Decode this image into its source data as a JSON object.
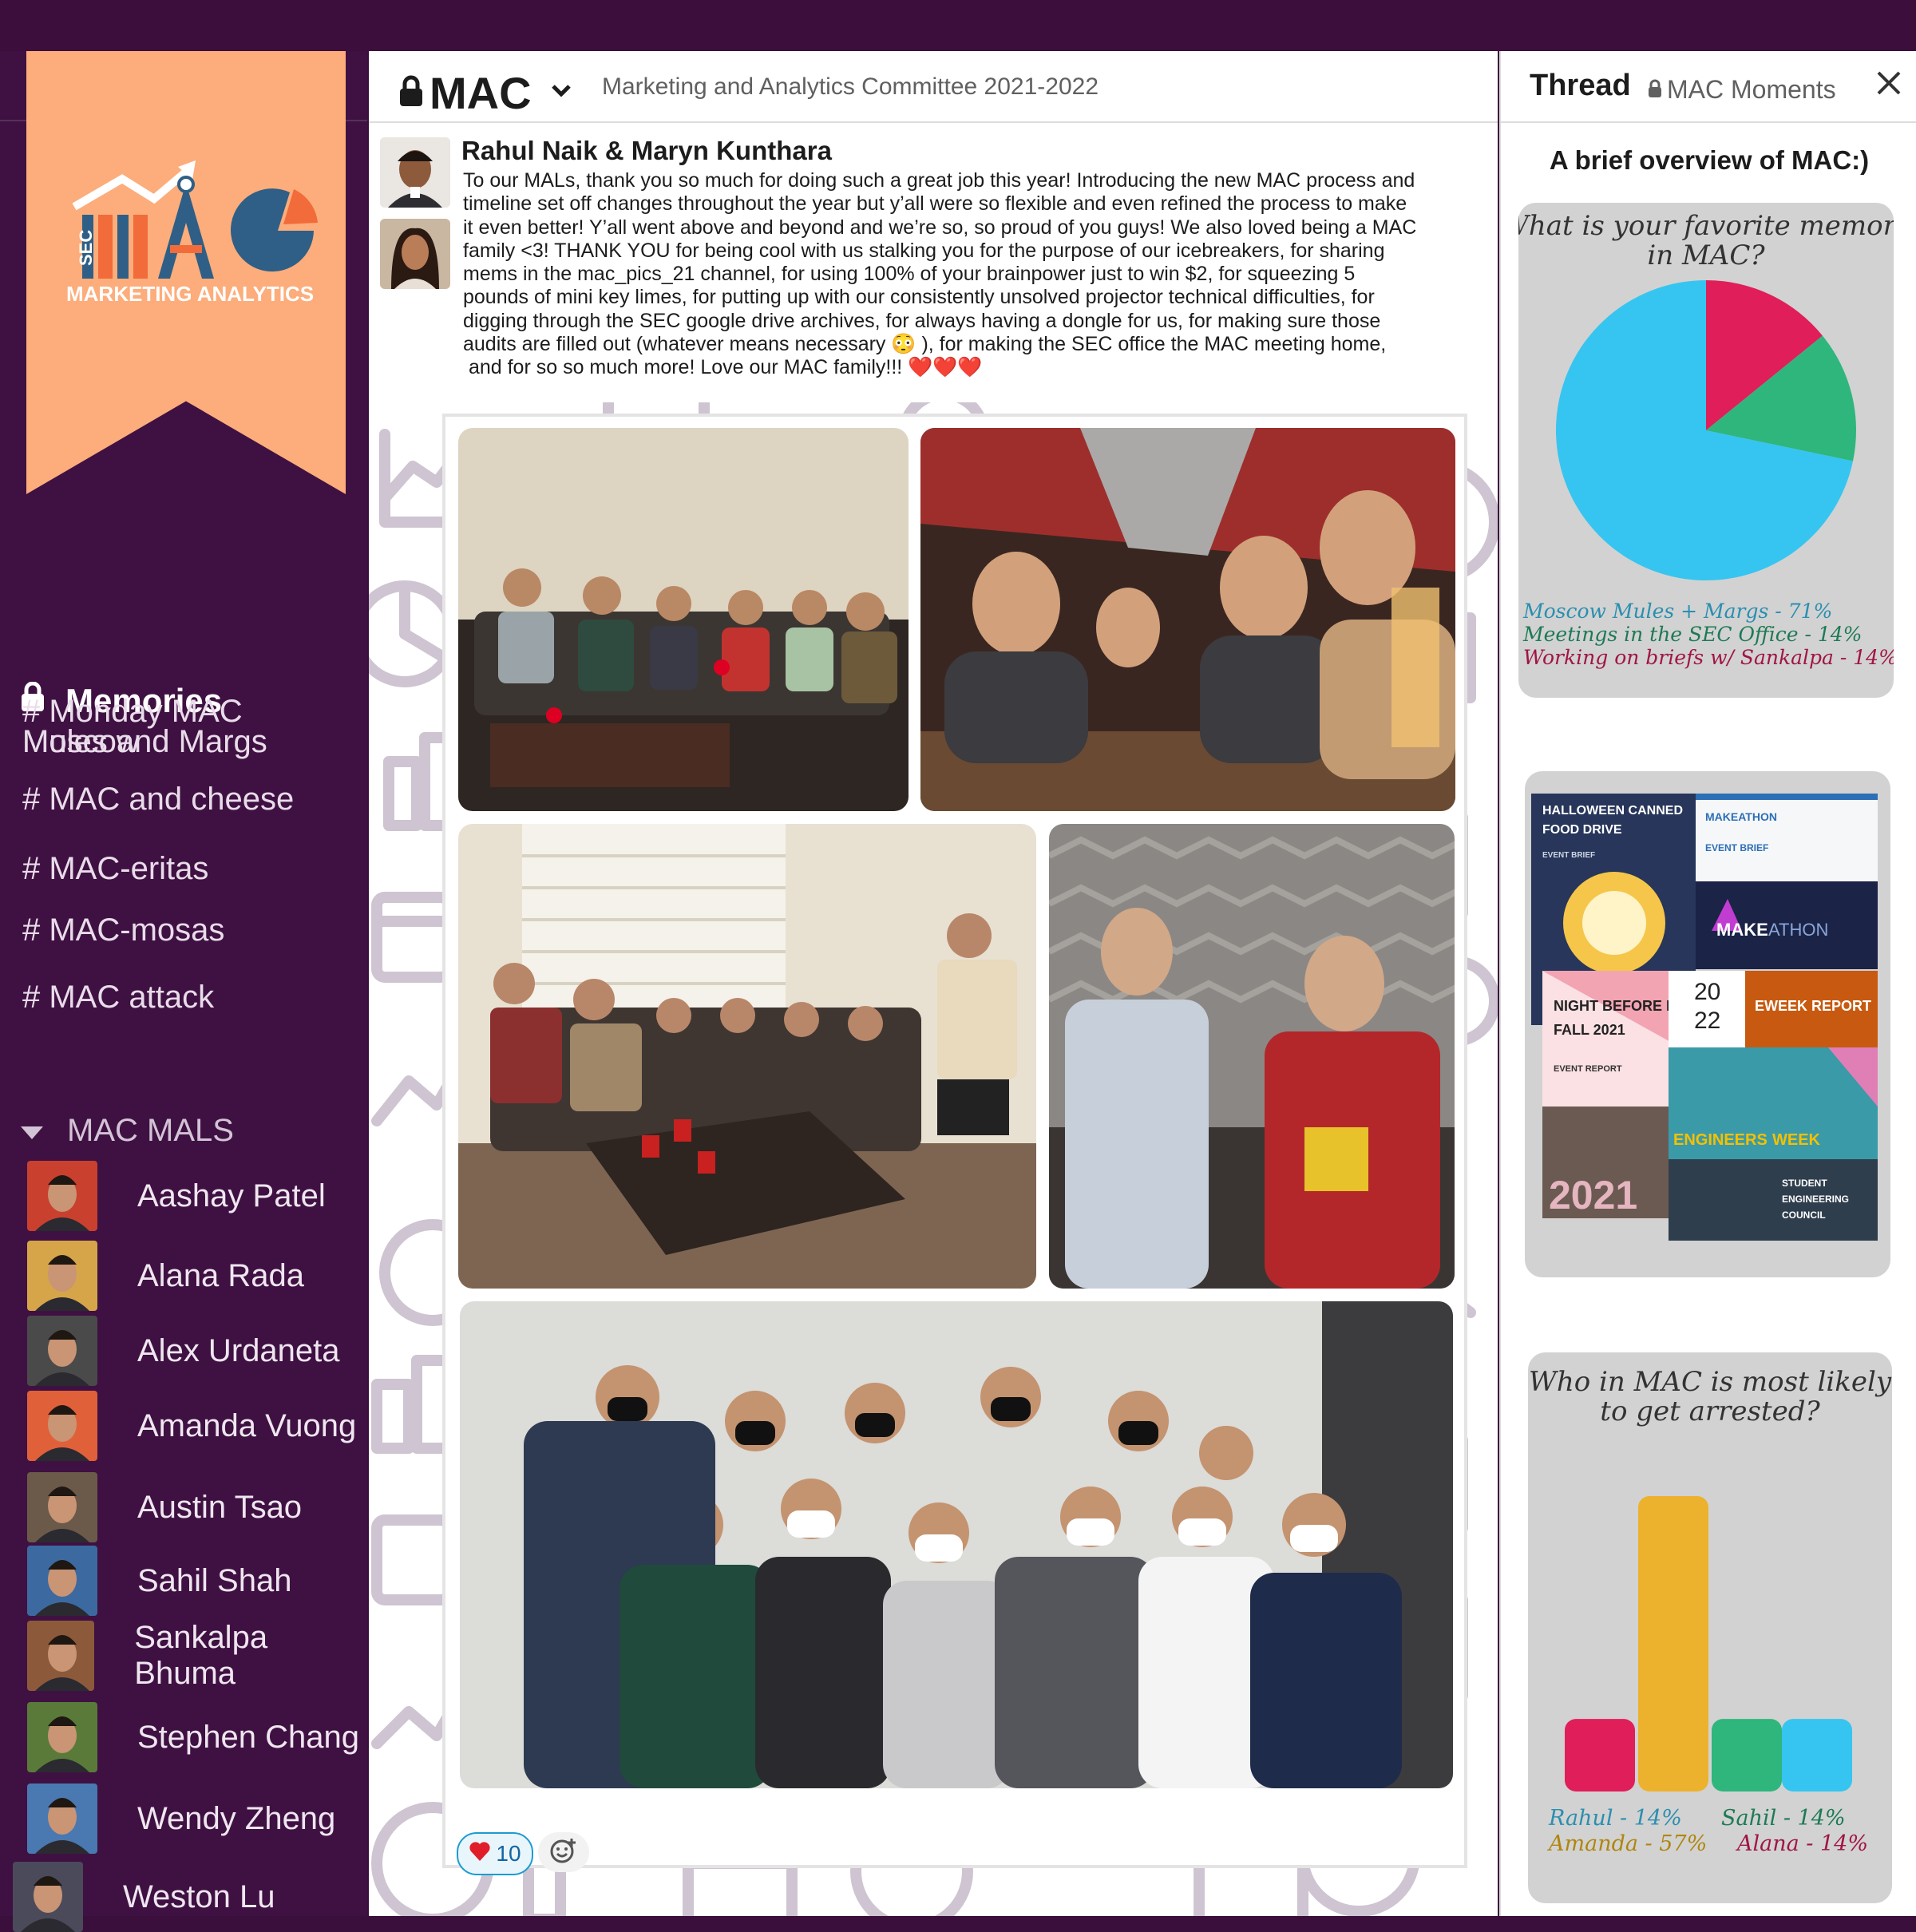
{
  "sidebar": {
    "logo": {
      "small": "SEC",
      "big": "MAC",
      "sub": "MARKETING ANALYTICS"
    },
    "workspace_title": "Memories",
    "channels": [
      "# Monday MAC Moscow",
      "Mules and Margs",
      "# MAC and cheese",
      "# MAC-eritas",
      "# MAC-mosas",
      "# MAC attack"
    ],
    "mals_header": "MAC MALS",
    "members": [
      "Aashay Patel",
      "Alana Rada",
      "Alex Urdaneta",
      "Amanda Vuong",
      "Austin Tsao",
      "Sahil Shah",
      "Sankalpa Bhuma",
      "Stephen Chang",
      "Wendy Zheng",
      "Weston Lu"
    ]
  },
  "header": {
    "channel": "MAC",
    "description": "Marketing and Analytics Committee 2021-2022"
  },
  "message": {
    "author": "Rahul Naik & Maryn Kunthara",
    "body_lines": [
      "To our MALs, thank you so much for doing such a great job this year! Introducing the new MAC process and",
      "timeline set off changes throughout the year but y’all were so flexible and even refined the process to make",
      "it even better! Y’all went above and beyond and we’re so, so proud of you guys! We also loved being a MAC",
      "family <3! THANK YOU for being cool with us stalking you for the purpose of our icebreakers, for sharing",
      "mems in the mac_pics_21 channel, for using 100% of your brainpower just to win $2, for squeezing 5",
      "pounds of mini key limes, for putting up with our consistently unsolved projector technical difficulties, for",
      "digging through the SEC google drive archives, for always having a dongle for us, for making sure those",
      "audits are filled out (whatever means necessary 😳 ), for making the SEC office the MAC meeting home,",
      " and for so so much more! Love our MAC family!!! ❤️❤️❤️"
    ],
    "reaction_count": "10"
  },
  "thread": {
    "title": "Thread",
    "channel": "MAC Moments",
    "overview_title": "A brief overview of MAC:)",
    "briefs": {
      "halloween": [
        "HALLOWEEN CANNED",
        "FOOD DRIVE",
        "EVENT BRIEF"
      ],
      "makeathon": [
        "MAKEATHON",
        "EVENT BRIEF",
        "MAKE",
        "ATHON"
      ],
      "nbe": [
        "NIGHT BEFORE EXP",
        "FALL 2021",
        "EVENT REPORT",
        "2021"
      ],
      "eweek": [
        "20",
        "22",
        "EWEEK REPORT",
        "ENGINEERS",
        "WEEK"
      ],
      "council": [
        "STUDENT",
        "ENGINEERING",
        "COUNCIL"
      ]
    }
  },
  "colors": {
    "purple": "#3f1142",
    "orange": "#fcad7b",
    "pink": "#e01e5a",
    "green": "#2eb67d",
    "blue": "#36c5f0",
    "yellow": "#ecb22e"
  },
  "chart_data": [
    {
      "type": "pie",
      "title": "What is your favorite memory in MAC?",
      "categories": [
        "Moscow Mules + Margs",
        "Meetings in the SEC Office",
        "Working on briefs w/ Sankalpa"
      ],
      "values": [
        71,
        14,
        14
      ],
      "legend": [
        "Moscow Mules + Margs - 71%",
        "Meetings in the SEC Office - 14%",
        "Working on briefs w/ Sankalpa - 14%"
      ],
      "colors": [
        "#36c5f0",
        "#2eb67d",
        "#e01e5a"
      ]
    },
    {
      "type": "bar",
      "title": "Who in MAC is most likely to get arrested?",
      "categories": [
        "Alana",
        "Amanda",
        "Rahul",
        "Sahil"
      ],
      "values": [
        14,
        57,
        14,
        14
      ],
      "legend": [
        "Rahul - 14%",
        "Sahil - 14%",
        "Amanda - 57%",
        "Alana - 14%"
      ],
      "colors": [
        "#e01e5a",
        "#ecb22e",
        "#2eb67d",
        "#36c5f0"
      ],
      "ylim": [
        0,
        57
      ]
    }
  ]
}
